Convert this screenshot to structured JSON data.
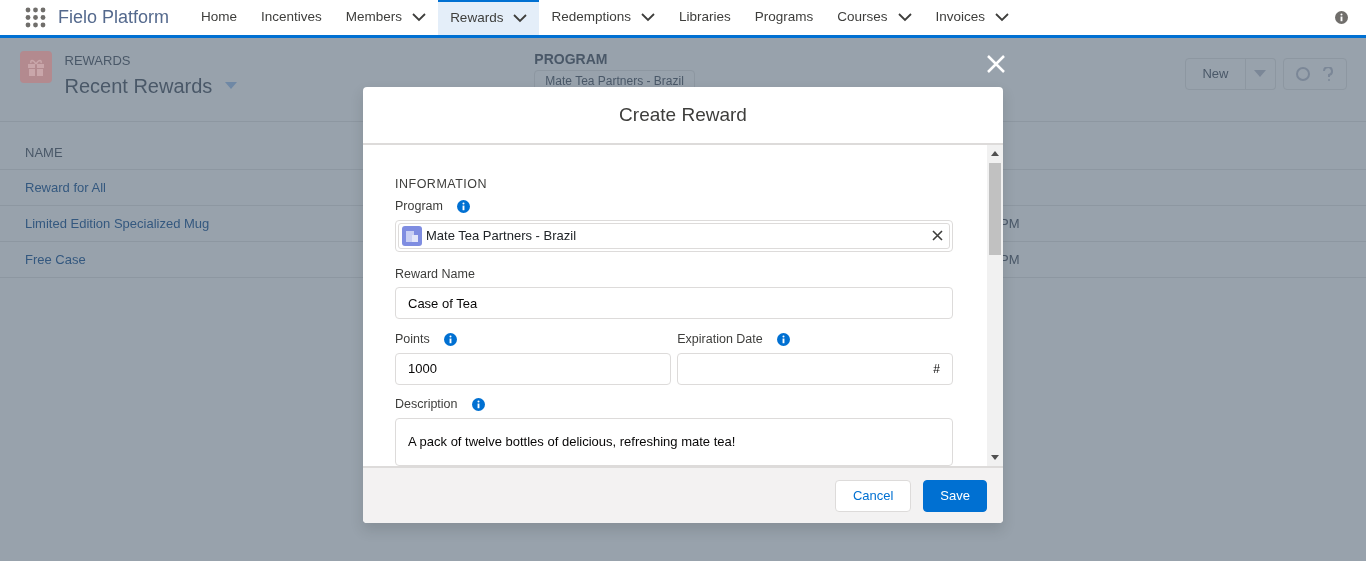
{
  "app": {
    "name": "Fielo Platform"
  },
  "nav": [
    {
      "label": "Home",
      "dropdown": false,
      "selected": false
    },
    {
      "label": "Incentives",
      "dropdown": false,
      "selected": false
    },
    {
      "label": "Members",
      "dropdown": true,
      "selected": false
    },
    {
      "label": "Rewards",
      "dropdown": true,
      "selected": true
    },
    {
      "label": "Redemptions",
      "dropdown": true,
      "selected": false
    },
    {
      "label": "Libraries",
      "dropdown": false,
      "selected": false
    },
    {
      "label": "Programs",
      "dropdown": false,
      "selected": false
    },
    {
      "label": "Courses",
      "dropdown": true,
      "selected": false
    },
    {
      "label": "Invoices",
      "dropdown": true,
      "selected": false
    }
  ],
  "list_view": {
    "object": "REWARDS",
    "title": "Recent Rewards",
    "program_label": "PROGRAM",
    "program_value": "Mate Tea Partners - Brazil",
    "new_button": "New",
    "columns": [
      "NAME"
    ],
    "rows": [
      {
        "name": "Reward for All"
      },
      {
        "name": "Limited Edition Specialized Mug",
        "column_2": "PM"
      },
      {
        "name": "Free Case",
        "column_2": "PM"
      }
    ]
  },
  "modal": {
    "title": "Create Reward",
    "section": "INFORMATION",
    "program": {
      "label": "Program",
      "value": "Mate Tea Partners - Brazil"
    },
    "fields": [
      {
        "label": "Reward Name",
        "value": "Case of Tea",
        "info": false,
        "kind": "text"
      },
      {
        "label": "Points",
        "value": "1000",
        "info": true,
        "kind": "number"
      },
      {
        "label": "Expiration Date",
        "info": true,
        "kind": "date",
        "icon": "#"
      },
      {
        "label": "Description",
        "value": "A pack of twelve bottles of delicious, refreshing mate tea!",
        "info": true,
        "kind": "textarea"
      }
    ],
    "buttons": [
      {
        "label": "Cancel",
        "kind": "neutral"
      },
      {
        "label": "Save",
        "kind": "brand"
      }
    ]
  }
}
